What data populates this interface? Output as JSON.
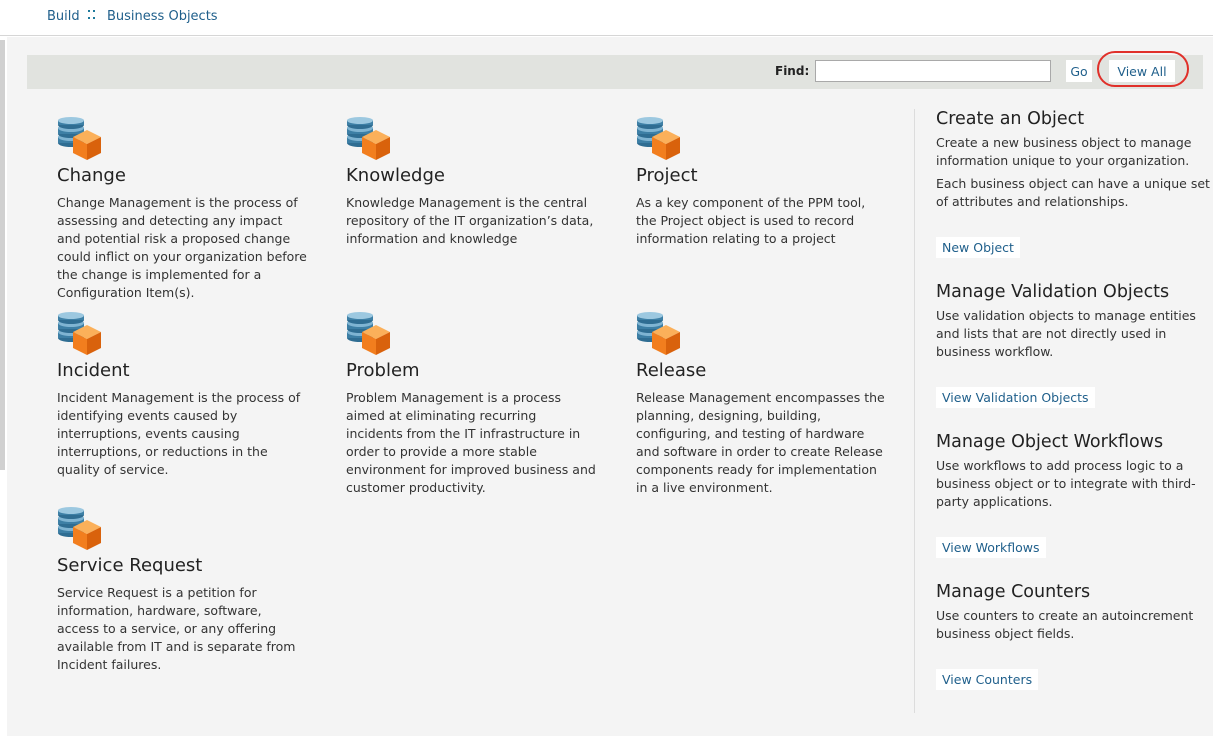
{
  "breadcrumb": {
    "root": "Build",
    "current": "Business Objects"
  },
  "search": {
    "label": "Find:",
    "placeholder": "",
    "value": "",
    "go_label": "Go",
    "view_all_label": "View All"
  },
  "objects": [
    {
      "title": "Change",
      "description": "Change Management is the process of assessing and detecting any impact and potential risk a proposed change could inflict on your organization before the change is implemented for a Configuration Item(s)."
    },
    {
      "title": "Knowledge",
      "description": "Knowledge Management is the central repository of the IT organization’s data, information and knowledge"
    },
    {
      "title": "Project",
      "description": "As a key component of the PPM tool, the Project object is used to record information relating to a project"
    },
    {
      "title": "Incident",
      "description": "Incident Management is the process of identifying events caused by interruptions, events causing interruptions, or reductions in the quality of service."
    },
    {
      "title": "Problem",
      "description": "Problem Management is a process aimed at eliminating recurring incidents from the IT infrastructure in order to provide a more stable environment for improved business and customer productivity."
    },
    {
      "title": "Release",
      "description": "Release Management encompasses the planning, designing, building, configuring, and testing of hardware and software in order to create Release components ready for implementation in a live environment."
    },
    {
      "title": "Service Request",
      "description": "Service Request is a petition for information, hardware, software, access to a service, or any offering available from IT and is separate from Incident failures."
    }
  ],
  "sidebar": {
    "create": {
      "title": "Create an Object",
      "text1": "Create a new business object to manage information unique to your organization.",
      "text2": "Each business object can have a unique set of attributes and relationships.",
      "button": "New Object"
    },
    "validation": {
      "title": "Manage Validation Objects",
      "text": "Use validation objects to manage entities and lists that are not directly used in business workflow.",
      "button": "View Validation Objects"
    },
    "workflows": {
      "title": "Manage Object Workflows",
      "text": "Use workflows to add process logic to a business object or to integrate with third-party applications.",
      "button": "View Workflows"
    },
    "counters": {
      "title": "Manage Counters",
      "text": "Use counters to create an autoincrement business object fields.",
      "button": "View Counters"
    }
  },
  "colors": {
    "link": "#1f5f8b",
    "highlight_ring": "#e0302a",
    "db_blue": "#3d7fa5",
    "box_orange": "#f27e1e"
  },
  "icons": {
    "object": "database-box-icon",
    "separator": "dots-separator-icon"
  }
}
